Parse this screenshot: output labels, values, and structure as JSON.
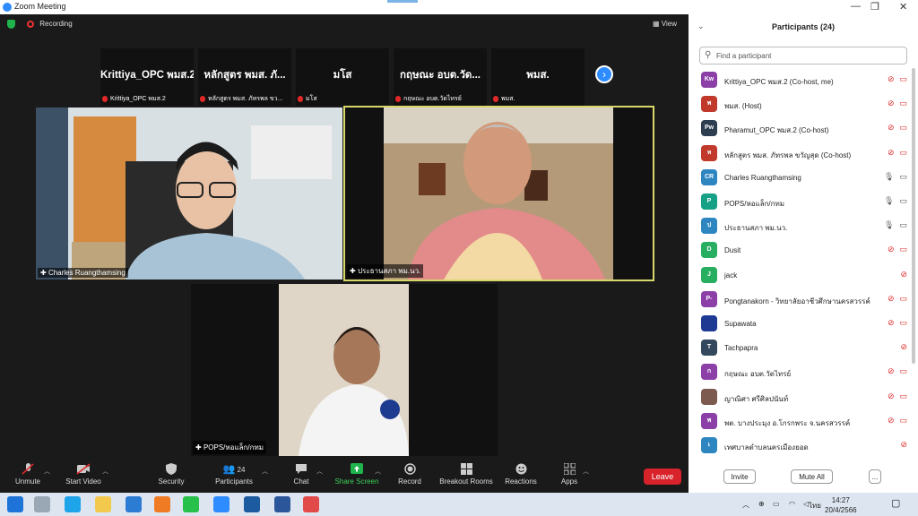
{
  "window": {
    "title": "Zoom Meeting"
  },
  "meeting": {
    "recording_label": "Recording",
    "view_label": "View",
    "strip": [
      {
        "display": "Krittiya_OPC พมส.2",
        "label": "Krittiya_OPC พมส.2"
      },
      {
        "display": "หลักสูตร พมส. ภั...",
        "label": "หลักสูตร พมส. ภัทรพล ขว..."
      },
      {
        "display": "มโส",
        "label": "มโส"
      },
      {
        "display": "กฤษณะ อบต.วัด...",
        "label": "กฤษณะ อบต.วัดไทรย์"
      },
      {
        "display": "พมส.",
        "label": "พมส."
      }
    ],
    "videos": {
      "v1": "Charles Ruangthamsing",
      "v2": "ประธานสภา พม.นว.",
      "v3": "POPS/หอแล็ก/กทม"
    }
  },
  "controls": {
    "unmute": "Unmute",
    "start_video": "Start Video",
    "security": "Security",
    "participants": "Participants",
    "participants_count": "24",
    "chat": "Chat",
    "share_screen": "Share Screen",
    "record": "Record",
    "breakout": "Breakout Rooms",
    "reactions": "Reactions",
    "apps": "Apps",
    "leave": "Leave"
  },
  "panel": {
    "title": "Participants (24)",
    "search_placeholder": "Find a participant",
    "invite": "Invite",
    "mute_all": "Mute All",
    "more": "...",
    "participants": [
      {
        "initials": "Kw",
        "color": "#8b3fa7",
        "name": "Krittiya_OPC พมส.2 (Co-host, me)",
        "mic": "off",
        "video": "off"
      },
      {
        "initials": "พ",
        "color": "#c0392b",
        "name": "พมส. (Host)",
        "mic": "off",
        "video": "off"
      },
      {
        "initials": "Pw",
        "color": "#2c3e50",
        "name": "Pharamut_OPC พมส.2 (Co-host)",
        "mic": "off",
        "video": "off"
      },
      {
        "initials": "ห",
        "color": "#c0392b",
        "name": "หลักสูตร พมส. ภัทรพล ขวัญสุด (Co-host)",
        "mic": "off",
        "video": "off"
      },
      {
        "initials": "CR",
        "color": "#2e86c1",
        "name": "Charles Ruangthamsing",
        "mic": "on",
        "video": "on"
      },
      {
        "initials": "P",
        "color": "#16a085",
        "name": "POPS/หอแล็ก/กทม",
        "mic": "on",
        "video": "on"
      },
      {
        "initials": "ป",
        "color": "#2e86c1",
        "name": "ประธานสภา พม.นว.",
        "mic": "on",
        "video": "on"
      },
      {
        "initials": "D",
        "color": "#27ae60",
        "name": "Dusit",
        "mic": "off",
        "video": "off"
      },
      {
        "initials": "J",
        "color": "#27ae60",
        "name": "jack",
        "mic": "off",
        "video": ""
      },
      {
        "initials": "P-",
        "color": "#8b3fa7",
        "name": "Pongtanakorn - วิทยาลัยอาชีวศึกษานครสวรรค์",
        "mic": "off",
        "video": "off"
      },
      {
        "initials": "",
        "color": "#1f3a93",
        "name": "Supawata",
        "mic": "off",
        "video": "off"
      },
      {
        "initials": "T",
        "color": "#34495e",
        "name": "Tachpapra",
        "mic": "off",
        "video": ""
      },
      {
        "initials": "ก",
        "color": "#8b3fa7",
        "name": "กฤษณะ อบต.วัดไทรย์",
        "mic": "off",
        "video": "off"
      },
      {
        "initials": "",
        "color": "#7d5a50",
        "name": "ญาณิศา ศรีศิลปนันท์",
        "mic": "off",
        "video": "off"
      },
      {
        "initials": "พ",
        "color": "#8b3fa7",
        "name": "พต. บางประมุง อ.โกรกพระ จ.นครสวรรค์",
        "mic": "off",
        "video": "off"
      },
      {
        "initials": "เ",
        "color": "#2e86c1",
        "name": "เทศบาลตำบลนครเมืองยอด",
        "mic": "off",
        "video": ""
      }
    ]
  },
  "taskbar": {
    "time": "14:27",
    "date": "20/4/2566",
    "lang": "ไทย"
  }
}
